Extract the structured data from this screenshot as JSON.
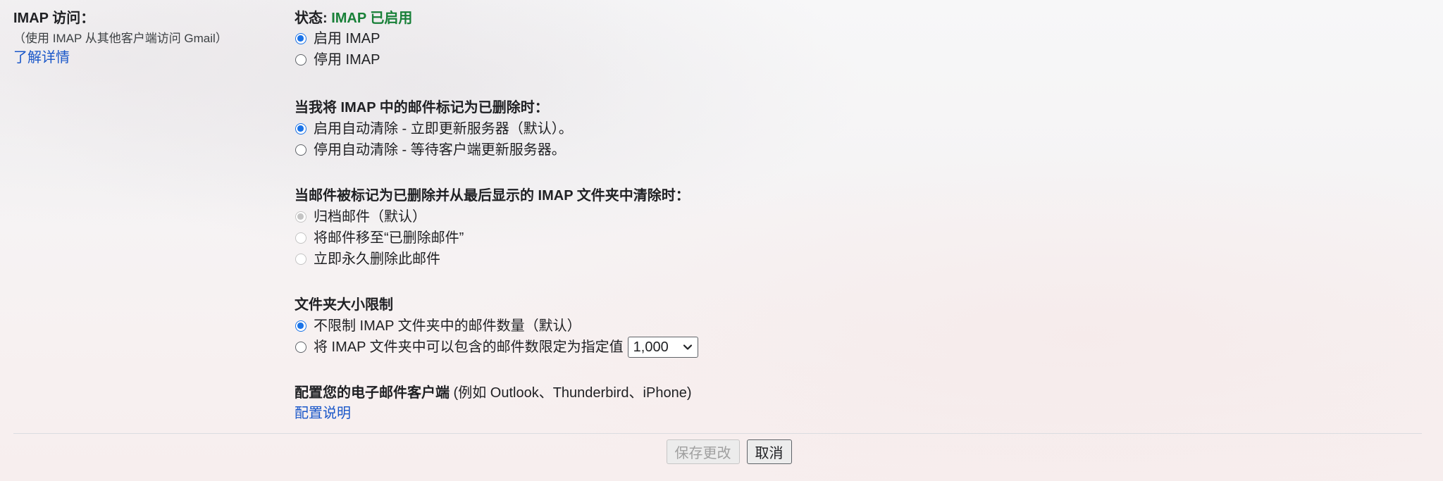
{
  "left": {
    "heading": "IMAP 访问：",
    "subtext": "（使用 IMAP 从其他客户端访问 Gmail）",
    "learn_more": "了解详情"
  },
  "imap_status": {
    "label": "状态: ",
    "value": "IMAP 已启用",
    "options": [
      {
        "label": "启用 IMAP",
        "selected": true
      },
      {
        "label": "停用 IMAP",
        "selected": false
      }
    ]
  },
  "expunge": {
    "title": "当我将 IMAP 中的邮件标记为已删除时：",
    "options": [
      {
        "label": "启用自动清除 - 立即更新服务器（默认）。",
        "selected": true
      },
      {
        "label": "停用自动清除 - 等待客户端更新服务器。",
        "selected": false
      }
    ]
  },
  "deleted_action": {
    "title": "当邮件被标记为已删除并从最后显示的 IMAP 文件夹中清除时：",
    "disabled": true,
    "options": [
      {
        "label": "归档邮件（默认）",
        "selected": true
      },
      {
        "label": "将邮件移至“已删除邮件”",
        "selected": false
      },
      {
        "label": "立即永久删除此邮件",
        "selected": false
      }
    ]
  },
  "folder_size": {
    "title": "文件夹大小限制",
    "options": [
      {
        "label": "不限制 IMAP 文件夹中的邮件数量（默认）",
        "selected": true
      },
      {
        "label": "将 IMAP 文件夹中可以包含的邮件数限定为指定值",
        "selected": false
      }
    ],
    "limit_select_value": "1,000"
  },
  "client_config": {
    "title": "配置您的电子邮件客户端",
    "examples": " (例如 Outlook、Thunderbird、iPhone)",
    "instructions_link": "配置说明"
  },
  "buttons": {
    "save": "保存更改",
    "cancel": "取消"
  },
  "colors": {
    "link": "#1a57c9",
    "status_enabled": "#188038",
    "radio_checked": "#1a73e8"
  },
  "icons": {
    "select_arrow": "chevron-down-icon"
  }
}
